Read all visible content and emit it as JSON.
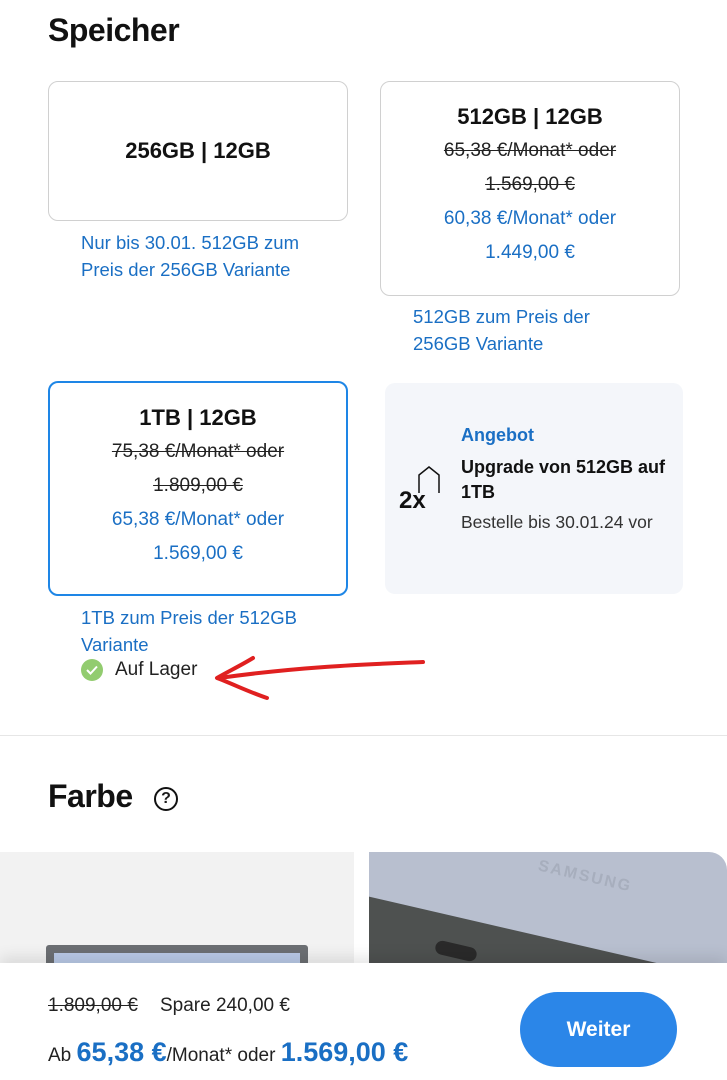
{
  "storage": {
    "title": "Speicher",
    "options": [
      {
        "name": "256GB | 12GB",
        "promo": [
          "Nur bis 30.01. 512GB zum",
          "Preis der 256GB Variante"
        ]
      },
      {
        "name": "512GB | 12GB",
        "old_monthly": "65,38 €/Monat* oder",
        "old_price": "1.569,00 €",
        "monthly": "60,38 €/Monat* oder",
        "price": "1.449,00 €",
        "promo": [
          "512GB zum Preis der",
          "256GB Variante"
        ]
      },
      {
        "name": "1TB | 12GB",
        "old_monthly": "75,38 €/Monat* oder",
        "old_price": "1.809,00 €",
        "monthly": "65,38 €/Monat* oder",
        "price": "1.569,00 €",
        "promo": [
          "1TB zum Preis der 512GB",
          "Variante"
        ]
      }
    ],
    "offer": {
      "icon_text": "2x",
      "label": "Angebot",
      "headline": "Upgrade von 512GB auf 1TB",
      "subtext": "Bestelle bis 30.01.24 vor"
    },
    "stock": "Auf Lager"
  },
  "color": {
    "title": "Farbe",
    "help_icon": "?",
    "brand_text": "SAMSUNG"
  },
  "footer": {
    "old_total": "1.809,00 €",
    "savings": "Spare 240,00 €",
    "prefix": "Ab",
    "monthly": "65,38 €",
    "monthly_suffix": "/Monat* oder",
    "total": "1.569,00 €",
    "button": "Weiter"
  },
  "colors": {
    "accent": "#1e86e6",
    "link": "#1a6fc4",
    "stock": "#92cc6f",
    "annotation": "#e02020"
  }
}
